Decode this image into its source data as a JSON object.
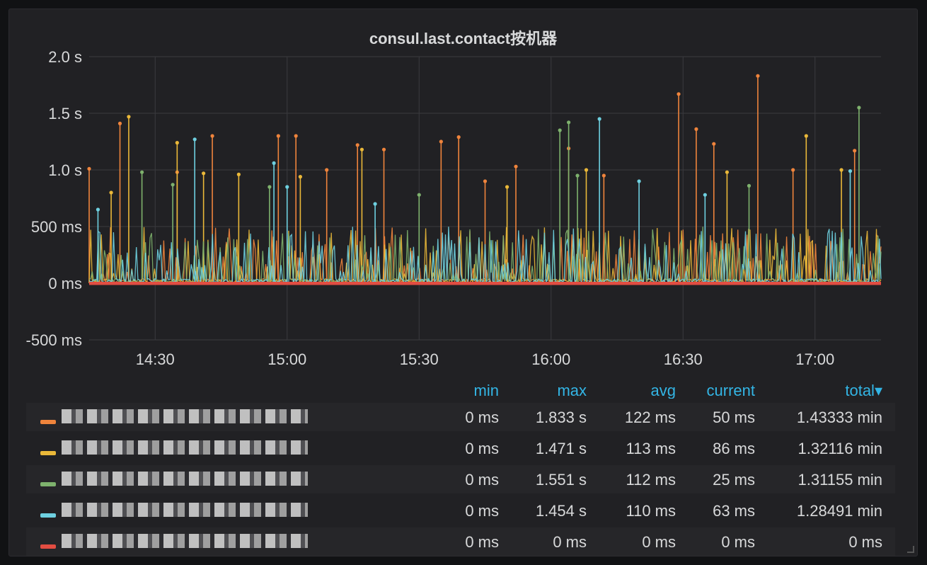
{
  "panel": {
    "title": "consul.last.contact按机器"
  },
  "chart_data": {
    "type": "line",
    "title": "consul.last.contact按机器",
    "y_unit": "ms",
    "ylim": [
      -500,
      2000
    ],
    "y_ticks": [
      {
        "value": 2000,
        "label": "2.0 s"
      },
      {
        "value": 1500,
        "label": "1.5 s"
      },
      {
        "value": 1000,
        "label": "1.0 s"
      },
      {
        "value": 500,
        "label": "500 ms"
      },
      {
        "value": 0,
        "label": "0 ms"
      },
      {
        "value": -500,
        "label": "-500 ms"
      }
    ],
    "x_range": [
      "14:15",
      "17:15"
    ],
    "x_ticks": [
      "14:30",
      "15:00",
      "15:30",
      "16:00",
      "16:30",
      "17:00"
    ],
    "grid": true,
    "series": [
      {
        "color": "#ef843c",
        "peaks": [
          [
            "14:15",
            1010
          ],
          [
            "14:22",
            1410
          ],
          [
            "14:43",
            1300
          ],
          [
            "14:58",
            1300
          ],
          [
            "15:02",
            1300
          ],
          [
            "15:09",
            1000
          ],
          [
            "15:16",
            1220
          ],
          [
            "15:22",
            1180
          ],
          [
            "15:35",
            1250
          ],
          [
            "15:39",
            1290
          ],
          [
            "15:52",
            1030
          ],
          [
            "16:04",
            1190
          ],
          [
            "16:29",
            1670
          ],
          [
            "16:33",
            1360
          ],
          [
            "16:37",
            1230
          ],
          [
            "16:47",
            1830
          ],
          [
            "17:09",
            1170
          ],
          [
            "16:55",
            1000
          ],
          [
            "14:35",
            980
          ],
          [
            "15:45",
            900
          ],
          [
            "16:12",
            950
          ]
        ]
      },
      {
        "color": "#eab839",
        "peaks": [
          [
            "14:24",
            1470
          ],
          [
            "14:35",
            1240
          ],
          [
            "14:41",
            970
          ],
          [
            "14:49",
            960
          ],
          [
            "15:03",
            940
          ],
          [
            "15:17",
            1180
          ],
          [
            "16:08",
            1000
          ],
          [
            "16:40",
            980
          ],
          [
            "16:58",
            1300
          ],
          [
            "17:06",
            1000
          ],
          [
            "14:20",
            800
          ],
          [
            "15:50",
            850
          ]
        ]
      },
      {
        "color": "#7eb26d",
        "peaks": [
          [
            "14:27",
            980
          ],
          [
            "14:34",
            870
          ],
          [
            "16:02",
            1350
          ],
          [
            "16:04",
            1420
          ],
          [
            "16:06",
            950
          ],
          [
            "17:10",
            1550
          ],
          [
            "14:56",
            850
          ],
          [
            "15:30",
            780
          ],
          [
            "16:45",
            860
          ]
        ]
      },
      {
        "color": "#6ed0e0",
        "peaks": [
          [
            "14:39",
            1270
          ],
          [
            "14:57",
            1060
          ],
          [
            "15:00",
            850
          ],
          [
            "16:11",
            1450
          ],
          [
            "17:08",
            990
          ],
          [
            "16:20",
            900
          ],
          [
            "14:17",
            650
          ],
          [
            "15:20",
            700
          ],
          [
            "16:35",
            780
          ]
        ]
      },
      {
        "color": "#e24d42",
        "peaks": []
      }
    ]
  },
  "legend": {
    "headers": {
      "min": "min",
      "max": "max",
      "avg": "avg",
      "current": "current",
      "total": "total"
    },
    "rows": [
      {
        "color": "#ef843c",
        "min": "0 ms",
        "max": "1.833 s",
        "avg": "122 ms",
        "current": "50 ms",
        "total": "1.43333 min"
      },
      {
        "color": "#eab839",
        "min": "0 ms",
        "max": "1.471 s",
        "avg": "113 ms",
        "current": "86 ms",
        "total": "1.32116 min"
      },
      {
        "color": "#7eb26d",
        "min": "0 ms",
        "max": "1.551 s",
        "avg": "112 ms",
        "current": "25 ms",
        "total": "1.31155 min"
      },
      {
        "color": "#6ed0e0",
        "min": "0 ms",
        "max": "1.454 s",
        "avg": "110 ms",
        "current": "63 ms",
        "total": "1.28491 min"
      },
      {
        "color": "#e24d42",
        "min": "0 ms",
        "max": "0 ms",
        "avg": "0 ms",
        "current": "0 ms",
        "total": "0 ms"
      }
    ]
  }
}
